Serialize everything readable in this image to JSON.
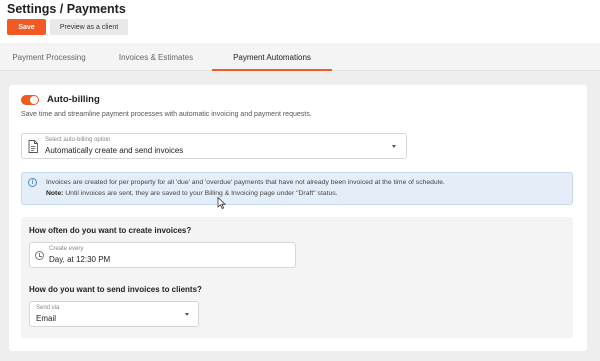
{
  "header": {
    "title": "Settings / Payments",
    "save_label": "Save",
    "preview_label": "Preview as a client"
  },
  "tabs": [
    {
      "label": "Payment Processing",
      "active": false
    },
    {
      "label": "Invoices & Estimates",
      "active": false
    },
    {
      "label": "Payment Automations",
      "active": true
    }
  ],
  "auto_billing": {
    "enabled": true,
    "title": "Auto-billing",
    "description": "Save time and streamline payment processes with automatic invoicing and payment requests.",
    "select_label": "Select auto-billing option",
    "select_value": "Automatically create and send invoices",
    "info_text": "Invoices are created for per property for all 'due' and 'overdue' payments that have not already been invoiced at the time of schedule.",
    "note_label": "Note:",
    "note_text": " Until invoices are sent, they are saved to your Billing & Invoicing page under \"Draft\" status."
  },
  "schedule": {
    "frequency_question": "How often do you want to create invoices?",
    "frequency_label": "Create every",
    "frequency_value": "Day, at 12:30 PM",
    "send_question": "How do you want to send invoices to clients?",
    "send_label": "Send via",
    "send_value": "Email"
  },
  "colors": {
    "accent": "#f15a24",
    "info_bg": "#e4eef8",
    "info_icon": "#4a86c5"
  },
  "icons": [
    "document-icon",
    "chevron-down-icon",
    "info-icon",
    "clock-icon",
    "mouse-cursor-icon"
  ]
}
